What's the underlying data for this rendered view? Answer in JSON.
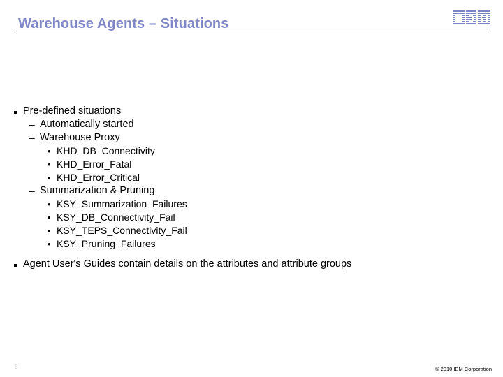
{
  "header": {
    "title": "Warehouse Agents – Situations",
    "title_color": "#8087c7",
    "logo_name": "IBM",
    "rule_color": "#000000"
  },
  "body": {
    "blocks": [
      {
        "level": 1,
        "marker": "square",
        "text": "Pre-defined situations"
      },
      {
        "level": 2,
        "marker": "–",
        "text": "Automatically started"
      },
      {
        "level": 2,
        "marker": "–",
        "text": "Warehouse Proxy"
      },
      {
        "level": 3,
        "marker": "•",
        "text": "KHD_DB_Connectivity"
      },
      {
        "level": 3,
        "marker": "•",
        "text": "KHD_Error_Fatal"
      },
      {
        "level": 3,
        "marker": "•",
        "text": "KHD_Error_Critical"
      },
      {
        "level": 2,
        "marker": "–",
        "text": "Summarization & Pruning"
      },
      {
        "level": 3,
        "marker": "•",
        "text": "KSY_Summarization_Failures"
      },
      {
        "level": 3,
        "marker": "•",
        "text": "KSY_DB_Connectivity_Fail"
      },
      {
        "level": 3,
        "marker": "•",
        "text": "KSY_TEPS_Connectivity_Fail"
      },
      {
        "level": 3,
        "marker": "•",
        "text": "KSY_Pruning_Failures"
      },
      {
        "level": 0,
        "marker": "gap",
        "text": ""
      },
      {
        "level": 1,
        "marker": "square",
        "text": "Agent User's Guides contain details on the attributes and attribute groups"
      }
    ]
  },
  "footer": {
    "page_number": "8",
    "copyright": "© 2010 IBM Corporation"
  }
}
